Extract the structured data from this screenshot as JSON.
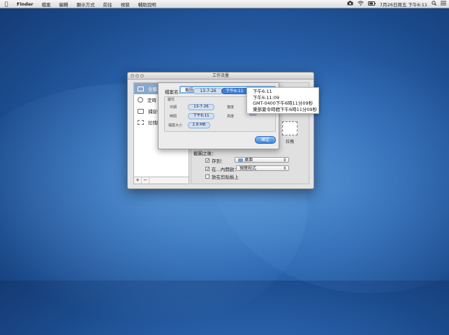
{
  "menubar": {
    "app_name": "Finder",
    "menus": [
      "檔案",
      "編輯",
      "顯示方式",
      "前往",
      "視窗",
      "輔助說明"
    ],
    "clock": "7月26日周五 下午6:11"
  },
  "window": {
    "title": "工作流量",
    "sidebar": [
      {
        "label": "全螢幕",
        "icon": "monitor-icon"
      },
      {
        "label": "定時",
        "icon": "clock-icon"
      },
      {
        "label": "捕捉視",
        "icon": "window-icon"
      },
      {
        "label": "拉拽區",
        "icon": "selection-icon"
      }
    ],
    "sidebar_add": "+",
    "sidebar_remove": "−",
    "drag_label": "拉拽",
    "after_capture_title": "截圖之後：",
    "options": [
      {
        "label": "存到：",
        "checked": true,
        "select": "桌面"
      },
      {
        "label": "在...內開啟：",
        "checked": true,
        "select": "預覽程式"
      },
      {
        "label": "放在剪貼板上",
        "checked": false
      }
    ]
  },
  "sheet": {
    "filename_label": "檔案名：",
    "tokens": [
      "截圖",
      "13-7-26",
      "下午6:11"
    ],
    "group_title": "屬性",
    "fields": [
      {
        "label": "日期",
        "value": "13-7-26"
      },
      {
        "label": "寬度",
        "value": ""
      },
      {
        "label": "時間",
        "value": "下午6:11"
      },
      {
        "label": "高度",
        "value": "900"
      },
      {
        "label": "檔案大小",
        "value": "2.8 MB"
      }
    ],
    "ok_label": "確定"
  },
  "popover": {
    "items": [
      "下午6:11",
      "下午6:11:09",
      "GMT-0400下午6時11分09秒",
      "東部夏令時間下午6時11分09秒"
    ]
  }
}
